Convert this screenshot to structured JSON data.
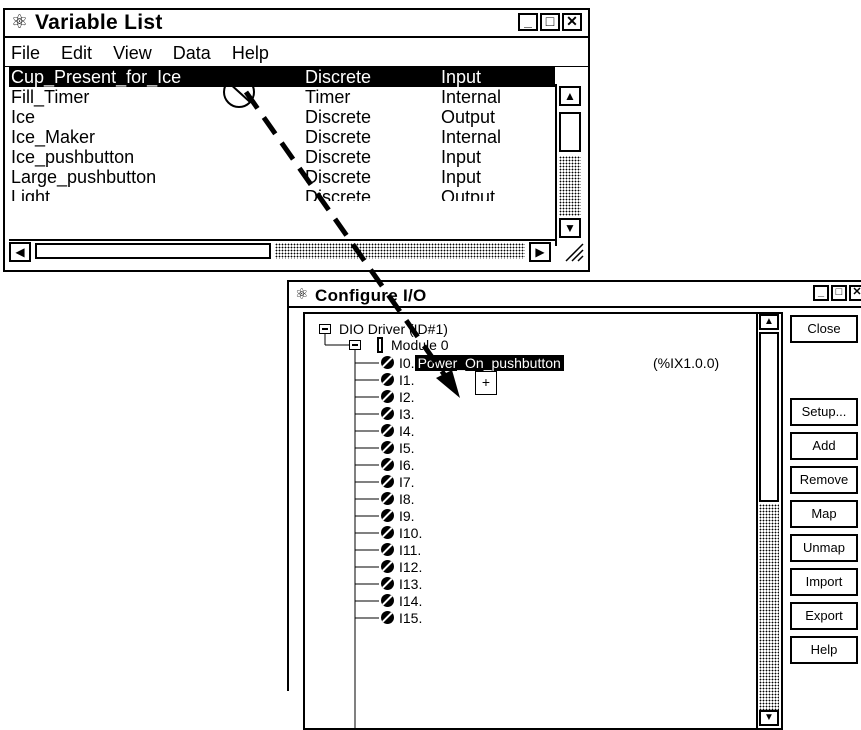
{
  "variable_list": {
    "title": "Variable List",
    "menus": [
      "File",
      "Edit",
      "View",
      "Data",
      "Help"
    ],
    "rows": [
      {
        "name": "Cup_Present_for_Ice",
        "type": "Discrete",
        "usage": "Input",
        "selected": true
      },
      {
        "name": "Fill_Timer",
        "type": "Timer",
        "usage": "Internal"
      },
      {
        "name": "Ice",
        "type": "Discrete",
        "usage": "Output"
      },
      {
        "name": "Ice_Maker",
        "type": "Discrete",
        "usage": "Internal"
      },
      {
        "name": "Ice_pushbutton",
        "type": "Discrete",
        "usage": "Input"
      },
      {
        "name": "Large_pushbutton",
        "type": "Discrete",
        "usage": "Input"
      },
      {
        "name": "Light",
        "type": "Discrete",
        "usage": "Output"
      }
    ]
  },
  "configure_io": {
    "title": "Configure I/O",
    "driver": "DIO Driver (ID#1)",
    "module": "Module 0",
    "mapped_tag": "Power_On_pushbutton",
    "mapped_address": "(%IX1.0.0)",
    "inputs": [
      "I0.",
      "I1.",
      "I2.",
      "I3.",
      "I4.",
      "I5.",
      "I6.",
      "I7.",
      "I8.",
      "I9.",
      "I10.",
      "I11.",
      "I12.",
      "I13.",
      "I14.",
      "I15."
    ],
    "buttons": [
      "Close",
      "Setup...",
      "Add",
      "Remove",
      "Map",
      "Unmap",
      "Import",
      "Export",
      "Help"
    ]
  },
  "icons": {
    "app": "atom-icon",
    "no_drop": "no-drop-cursor-icon",
    "drop_target": "drop-cursor-icon",
    "input_point": "input-point-icon"
  }
}
